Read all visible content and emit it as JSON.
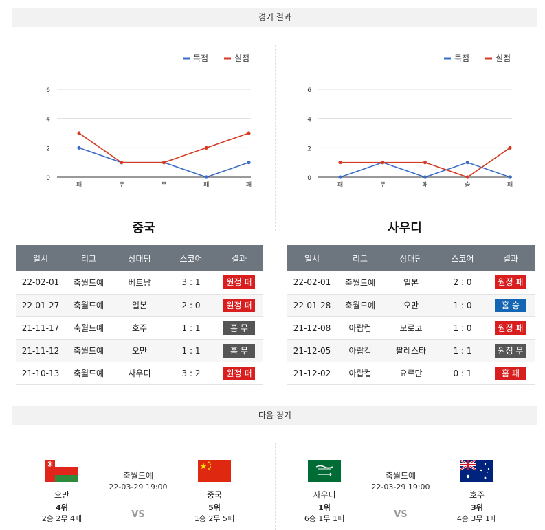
{
  "sections": {
    "results_title": "경기 결과",
    "next_title": "다음 경기"
  },
  "colors": {
    "score": "#3a6cc8",
    "concede": "#d43b22",
    "win": "#1565b5",
    "loss": "#d81e1e",
    "draw": "#555555"
  },
  "legend": {
    "score": "득점",
    "concede": "실점"
  },
  "chart_data": [
    {
      "type": "line",
      "categories": [
        "패",
        "무",
        "무",
        "패",
        "패"
      ],
      "series": [
        {
          "name": "득점",
          "values": [
            2,
            1,
            1,
            0,
            1
          ]
        },
        {
          "name": "실점",
          "values": [
            3,
            1,
            1,
            2,
            3
          ]
        }
      ],
      "ylim": [
        0,
        6
      ],
      "yticks": [
        0,
        2,
        4,
        6
      ],
      "grid": true,
      "legend_position": "top-right"
    },
    {
      "type": "line",
      "categories": [
        "패",
        "무",
        "패",
        "승",
        "패"
      ],
      "series": [
        {
          "name": "득점",
          "values": [
            0,
            1,
            0,
            1,
            0
          ]
        },
        {
          "name": "실점",
          "values": [
            1,
            1,
            1,
            0,
            2
          ]
        }
      ],
      "ylim": [
        0,
        6
      ],
      "yticks": [
        0,
        2,
        4,
        6
      ],
      "grid": true,
      "legend_position": "top-right"
    }
  ],
  "table_headers": [
    "일시",
    "리그",
    "상대팀",
    "스코어",
    "결과"
  ],
  "teams": [
    {
      "name": "중국",
      "rows": [
        {
          "date": "22-02-01",
          "league": "축월드예",
          "opponent": "베트남",
          "score": "3 : 1",
          "result": "원정 패",
          "kind": "loss"
        },
        {
          "date": "22-01-27",
          "league": "축월드예",
          "opponent": "일본",
          "score": "2 : 0",
          "result": "원정 패",
          "kind": "loss"
        },
        {
          "date": "21-11-17",
          "league": "축월드예",
          "opponent": "호주",
          "score": "1 : 1",
          "result": "홈 무",
          "kind": "draw"
        },
        {
          "date": "21-11-12",
          "league": "축월드예",
          "opponent": "오만",
          "score": "1 : 1",
          "result": "홈 무",
          "kind": "draw"
        },
        {
          "date": "21-10-13",
          "league": "축월드예",
          "opponent": "사우디",
          "score": "3 : 2",
          "result": "원정 패",
          "kind": "loss"
        }
      ]
    },
    {
      "name": "사우디",
      "rows": [
        {
          "date": "22-02-01",
          "league": "축월드예",
          "opponent": "일본",
          "score": "2 : 0",
          "result": "원정 패",
          "kind": "loss"
        },
        {
          "date": "22-01-28",
          "league": "축월드예",
          "opponent": "오만",
          "score": "1 : 0",
          "result": "홈 승",
          "kind": "win"
        },
        {
          "date": "21-12-08",
          "league": "아랍컵",
          "opponent": "모로코",
          "score": "1 : 0",
          "result": "원정 패",
          "kind": "loss"
        },
        {
          "date": "21-12-05",
          "league": "아랍컵",
          "opponent": "팔레스타",
          "score": "1 : 1",
          "result": "원정 무",
          "kind": "draw"
        },
        {
          "date": "21-12-02",
          "league": "아랍컵",
          "opponent": "요르단",
          "score": "0 : 1",
          "result": "홈 패",
          "kind": "loss"
        }
      ]
    }
  ],
  "next_matches": [
    {
      "league": "축월드예",
      "datetime": "22-03-29 19:00",
      "vs": "VS",
      "home": {
        "name": "오만",
        "rank": "4위",
        "record": "2승 2무 4패",
        "flag": "oman-flag"
      },
      "away": {
        "name": "중국",
        "rank": "5위",
        "record": "1승 2무 5패",
        "flag": "china-flag"
      }
    },
    {
      "league": "축월드예",
      "datetime": "22-03-29 19:00",
      "vs": "VS",
      "home": {
        "name": "사우디",
        "rank": "1위",
        "record": "6승 1무 1패",
        "flag": "saudi-flag"
      },
      "away": {
        "name": "호주",
        "rank": "3위",
        "record": "4승 3무 1패",
        "flag": "australia-flag"
      }
    }
  ]
}
